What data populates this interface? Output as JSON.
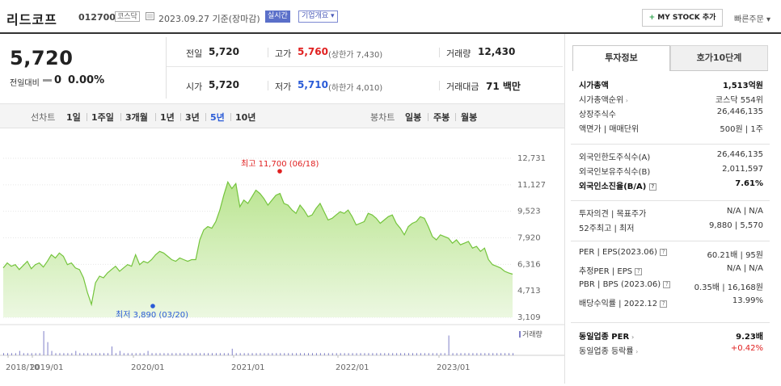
{
  "header": {
    "name": "리드코프",
    "code": "012700",
    "market_badge": "코스닥",
    "date_text": "2023.09.27 기준(장마감)",
    "realtime_label": "실시간",
    "overview_label": "기업개요 ▾",
    "mystock_label": "MY STOCK 추가",
    "mystock_plus": "+",
    "quick_order_label": "빠른주문 ▾"
  },
  "summary": {
    "price": "5,720",
    "change_label": "전일대비",
    "change_value": "0",
    "change_pct": "0.00%",
    "prev_label": "전일",
    "prev_value": "5,720",
    "high_label": "고가",
    "high_value": "5,760",
    "high_sub": "(상한가 7,430)",
    "volume_label": "거래량",
    "volume_value": "12,430",
    "open_label": "시가",
    "open_value": "5,720",
    "low_label": "저가",
    "low_value": "5,710",
    "low_sub": "(하한가 4,010)",
    "amount_label": "거래대금",
    "amount_value": "71 백만"
  },
  "periods": {
    "line_label": "선차트",
    "items": [
      "1일",
      "1주일",
      "3개월",
      "1년",
      "3년",
      "5년",
      "10년"
    ],
    "active_index": 5,
    "candle_label": "봉차트",
    "candle_items": [
      "일봉",
      "주봉",
      "월봉"
    ]
  },
  "chart_data": {
    "type": "area",
    "y_ticks": [
      "12,731",
      "11,127",
      "9,523",
      "7,920",
      "6,316",
      "4,713",
      "3,109"
    ],
    "ylim": [
      3109,
      12731
    ],
    "x_ticks": [
      "2018/10",
      "2019/01",
      "2020/01",
      "2021/01",
      "2022/01",
      "2023/01"
    ],
    "max_label": "최고 11,700 (06/18)",
    "min_label": "최저 3,890 (03/20)",
    "volume_label": "거래량",
    "series": [
      {
        "values": [
          6100,
          6400,
          6200,
          6300,
          6000,
          6250,
          6500,
          6050,
          6300,
          6400,
          6150,
          6500,
          6900,
          6700,
          7000,
          6800,
          6300,
          6400,
          6100,
          6000,
          5500,
          4600,
          3890,
          5200,
          5600,
          5500,
          5800,
          6000,
          6200,
          5900,
          6100,
          6300,
          6200,
          6900,
          6300,
          6500,
          6400,
          6600,
          6900,
          7100,
          7000,
          6800,
          6600,
          6500,
          6700,
          6600,
          6500,
          6600,
          6600,
          7800,
          8400,
          8600,
          8500,
          8900,
          9600,
          10500,
          11300,
          10900,
          11200,
          9800,
          10200,
          10000,
          10400,
          10800,
          10600,
          10300,
          9900,
          10200,
          10500,
          10600,
          10000,
          9900,
          9600,
          9400,
          9900,
          9600,
          9200,
          9300,
          9700,
          10000,
          9500,
          9000,
          9100,
          9300,
          9500,
          9400,
          9600,
          9200,
          8700,
          8800,
          8900,
          9400,
          9300,
          9100,
          8800,
          9000,
          9200,
          9300,
          8800,
          8500,
          8100,
          8600,
          8800,
          8900,
          9200,
          9100,
          8600,
          8000,
          7800,
          8100,
          8000,
          7900,
          7600,
          7800,
          7500,
          7600,
          7700,
          7300,
          7400,
          7100,
          7300,
          6600,
          6300,
          6200,
          6100,
          5900,
          5800,
          5720
        ]
      }
    ],
    "volume": [
      1,
      1,
      1,
      1,
      2,
      1,
      1,
      1,
      1,
      1,
      11,
      6,
      2,
      1,
      1,
      1,
      1,
      1,
      2,
      1,
      1,
      1,
      1,
      1,
      1,
      1,
      1,
      4,
      1,
      2,
      1,
      1,
      1,
      1,
      1,
      1,
      2,
      1,
      1,
      1,
      1,
      1,
      1,
      1,
      1,
      1,
      1,
      1,
      1,
      1,
      1,
      1,
      1,
      1,
      1,
      1,
      1,
      3,
      1,
      1,
      1,
      1,
      1,
      1,
      1,
      1,
      1,
      1,
      1,
      1,
      1,
      1,
      1,
      1,
      1,
      1,
      1,
      1,
      1,
      1,
      1,
      1,
      1,
      1,
      1,
      1,
      1,
      1,
      1,
      1,
      1,
      1,
      1,
      1,
      1,
      1,
      1,
      1,
      1,
      1,
      1,
      1,
      1,
      1,
      1,
      1,
      1,
      1,
      1,
      1,
      1,
      9,
      1,
      1,
      1,
      1,
      1,
      1,
      1,
      1,
      1,
      1,
      1,
      1,
      1,
      1,
      1,
      1
    ]
  },
  "right_panel": {
    "tab_active": "투자정보",
    "tab_inactive": "호가10단계",
    "group1": [
      {
        "label": "시가총액",
        "value": "1,513억원",
        "bold": true
      },
      {
        "label": "시가총액순위",
        "value": "코스닥 554위",
        "arrow": true
      },
      {
        "label": "상장주식수",
        "value": "26,446,135"
      },
      {
        "label": "액면가 | 매매단위",
        "value": "500원 | 1주"
      }
    ],
    "group2": [
      {
        "label": "외국인한도주식수(A)",
        "value": "26,446,135"
      },
      {
        "label": "외국인보유주식수(B)",
        "value": "2,011,597"
      },
      {
        "label": "외국인소진율(B/A)",
        "value": "7.61%",
        "bold": true,
        "help": true
      }
    ],
    "group3": [
      {
        "label": "투자의견 | 목표주가",
        "value": "N/A | N/A"
      },
      {
        "label": "52주최고 | 최저",
        "value": "9,880 | 5,570"
      }
    ],
    "group4": [
      {
        "label": "PER | EPS(2023.06)",
        "value": "60.21배 | 95원",
        "help": true
      },
      {
        "label": "추정PER | EPS",
        "value": "N/A | N/A",
        "help": true
      },
      {
        "label": "PBR | BPS (2023.06)",
        "value": "0.35배 | 16,168원",
        "help": true
      },
      {
        "label": "배당수익률 | 2022.12",
        "value": "13.99%",
        "help": true
      }
    ],
    "group5": [
      {
        "label": "동일업종 PER",
        "value": "9.23배",
        "bold": true,
        "arrow": true
      },
      {
        "label": "동일업종 등락률",
        "value": "+0.42%",
        "arrow": true,
        "red": true
      }
    ]
  }
}
